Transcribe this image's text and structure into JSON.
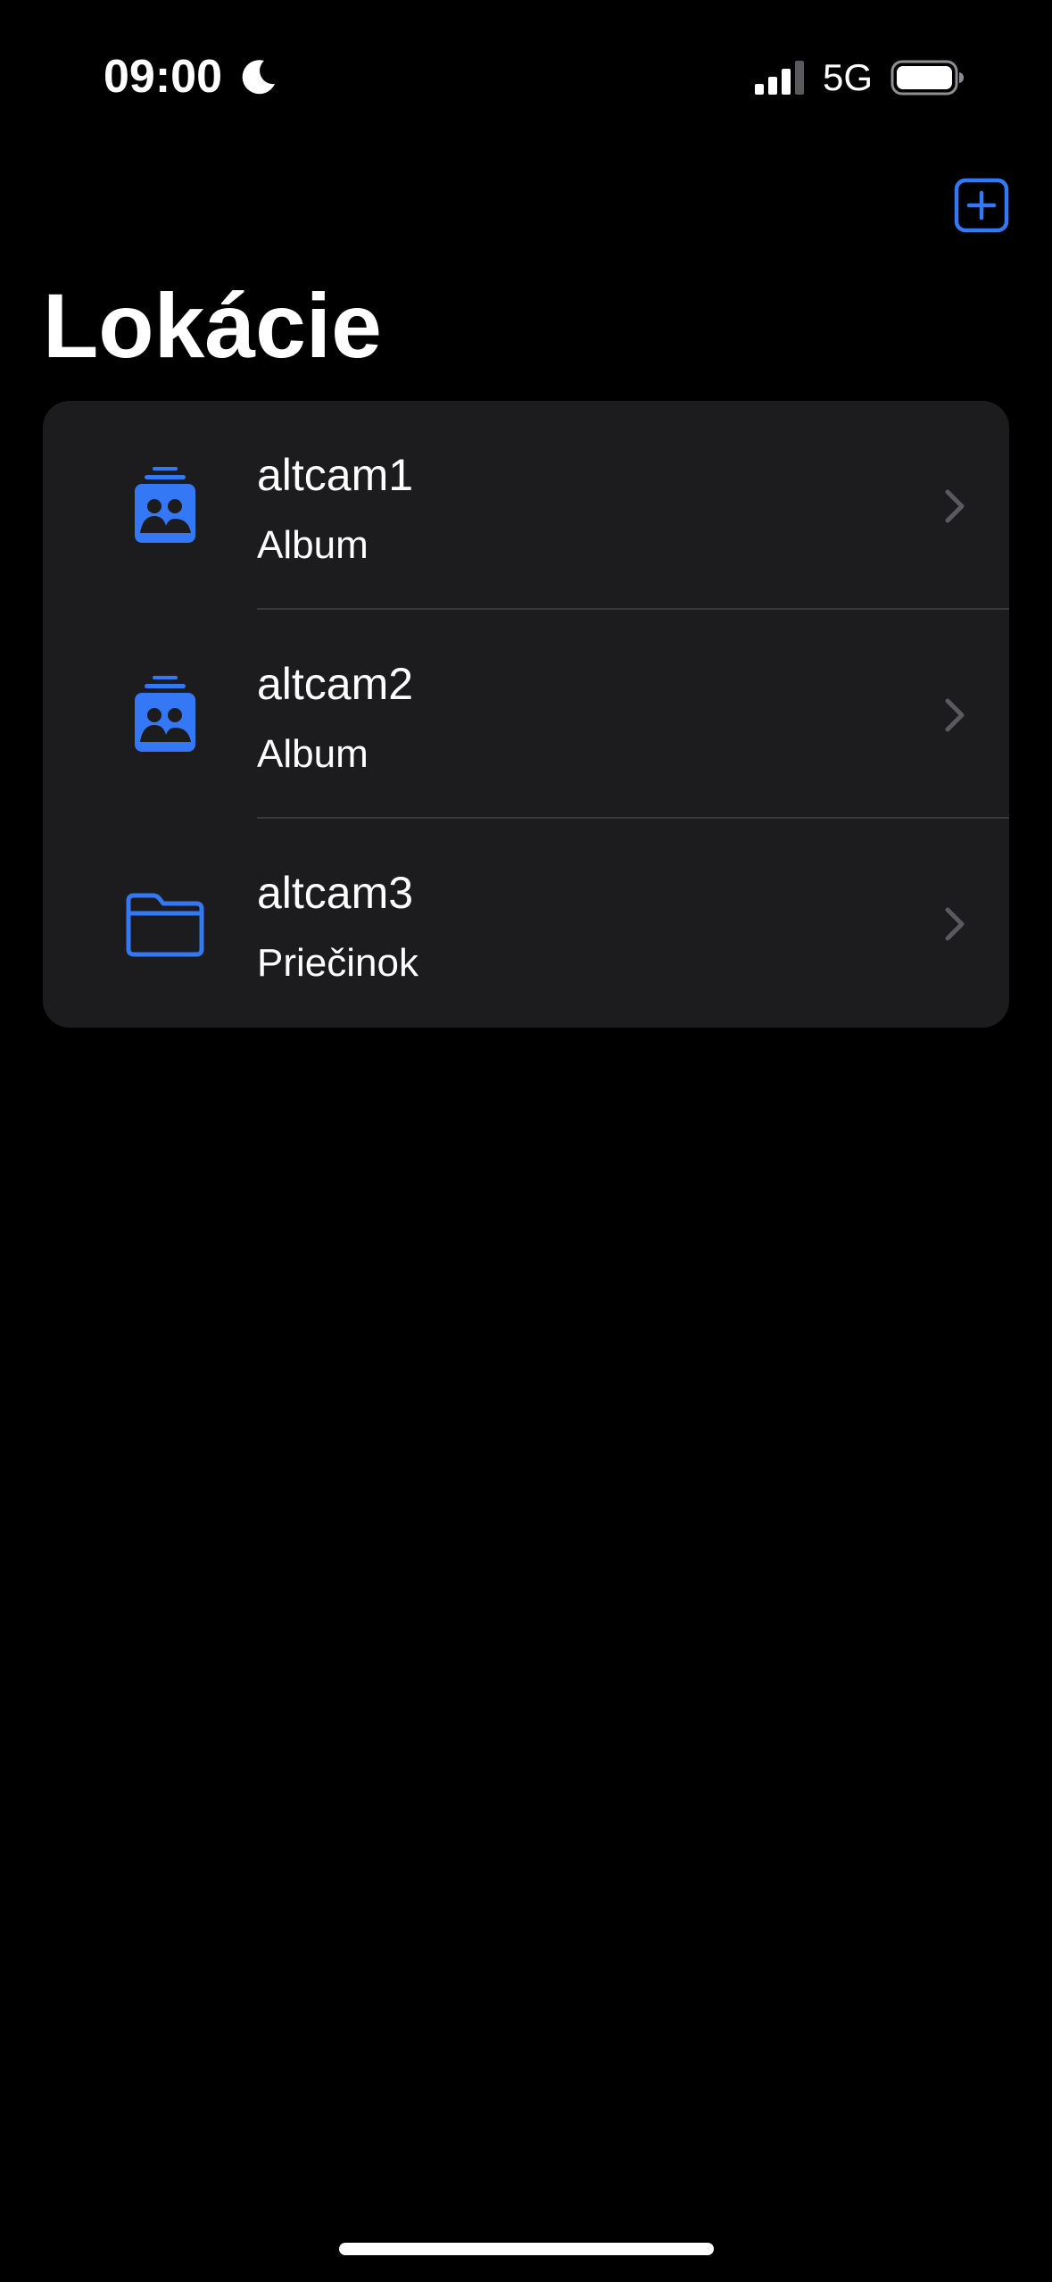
{
  "status_bar": {
    "time": "09:00",
    "network": "5G",
    "icons": [
      "moon-icon",
      "signal-icon",
      "battery-icon"
    ]
  },
  "nav": {
    "add_button_icon": "plus-square-icon",
    "title": "Lokácie"
  },
  "locations": [
    {
      "name": "altcam1",
      "type": "Album",
      "icon": "album-icon"
    },
    {
      "name": "altcam2",
      "type": "Album",
      "icon": "album-icon"
    },
    {
      "name": "altcam3",
      "type": "Priečinok",
      "icon": "folder-icon"
    }
  ],
  "colors": {
    "accent": "#3478f6",
    "background": "#000000",
    "card": "#1c1c1e",
    "chevron": "#5a5a5e"
  }
}
